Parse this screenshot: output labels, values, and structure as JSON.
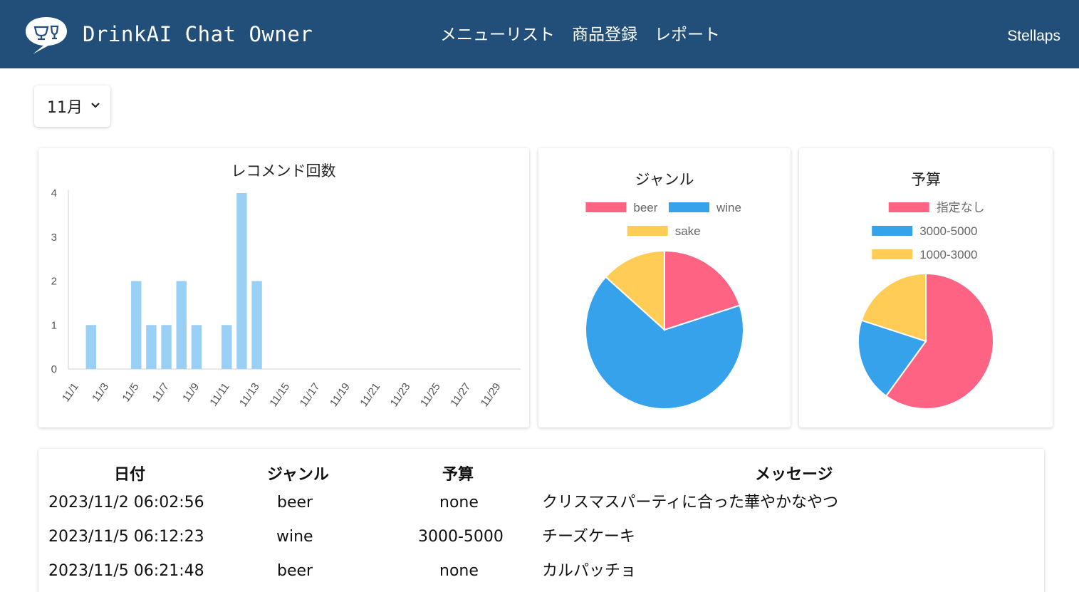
{
  "header": {
    "app_title": "DrinkAI Chat Owner",
    "nav": [
      "メニューリスト",
      "商品登録",
      "レポート"
    ],
    "user": "Stellaps",
    "logo_icon": "chat-bubble-glasses-icon"
  },
  "filter": {
    "month": "11月"
  },
  "colors": {
    "header_bg": "#224f7a",
    "bar": "#9ad0f5",
    "pink": "#ff6384",
    "blue": "#36a2eb",
    "yellow": "#ffcd56"
  },
  "chart_data": [
    {
      "type": "bar",
      "title": "レコメンド回数",
      "categories": [
        "11/1",
        "11/2",
        "11/3",
        "11/4",
        "11/5",
        "11/6",
        "11/7",
        "11/8",
        "11/9",
        "11/10",
        "11/11",
        "11/12",
        "11/13",
        "11/14",
        "11/15",
        "11/16",
        "11/17",
        "11/18",
        "11/19",
        "11/20",
        "11/21",
        "11/22",
        "11/23",
        "11/24",
        "11/25",
        "11/26",
        "11/27",
        "11/28",
        "11/29",
        "11/30"
      ],
      "tick_labels": [
        "11/1",
        "11/3",
        "11/5",
        "11/7",
        "11/9",
        "11/11",
        "11/13",
        "11/15",
        "11/17",
        "11/19",
        "11/21",
        "11/23",
        "11/25",
        "11/27",
        "11/29"
      ],
      "values": [
        0,
        1,
        0,
        0,
        2,
        1,
        1,
        2,
        1,
        0,
        1,
        4,
        2,
        0,
        0,
        0,
        0,
        0,
        0,
        0,
        0,
        0,
        0,
        0,
        0,
        0,
        0,
        0,
        0,
        0
      ],
      "ylim": [
        0,
        4
      ],
      "yticks": [
        "0",
        "1",
        "2",
        "3",
        "4"
      ],
      "grid": false
    },
    {
      "type": "pie",
      "title": "ジャンル",
      "labels": [
        "beer",
        "wine",
        "sake"
      ],
      "values": [
        3,
        10,
        2
      ],
      "colors": [
        "#ff6384",
        "#36a2eb",
        "#ffcd56"
      ],
      "legend": "top"
    },
    {
      "type": "pie",
      "title": "予算",
      "labels": [
        "指定なし",
        "3000-5000",
        "1000-3000"
      ],
      "values": [
        9,
        3,
        3
      ],
      "colors": [
        "#ff6384",
        "#36a2eb",
        "#ffcd56"
      ],
      "legend": "top"
    }
  ],
  "table": {
    "headers": [
      "日付",
      "ジャンル",
      "予算",
      "メッセージ"
    ],
    "rows": [
      [
        "2023/11/2 06:02:56",
        "beer",
        "none",
        "クリスマスパーティに合った華やかなやつ"
      ],
      [
        "2023/11/5 06:12:23",
        "wine",
        "3000-5000",
        "チーズケーキ"
      ],
      [
        "2023/11/5 06:21:48",
        "beer",
        "none",
        "カルパッチョ"
      ]
    ]
  }
}
